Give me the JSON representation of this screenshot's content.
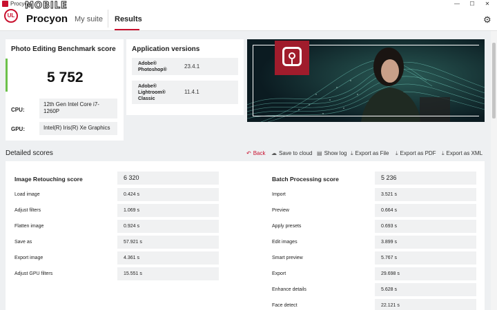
{
  "window": {
    "title": "Procyon",
    "controls": [
      "—",
      "☐",
      "✕"
    ]
  },
  "header": {
    "logo_text": "UL",
    "brand": "Procyon",
    "watermark": "MOBILE",
    "tabs": [
      {
        "label": "My suite",
        "active": false
      },
      {
        "label": "Results",
        "active": true
      }
    ],
    "settings_icon": "gear-icon"
  },
  "score_card": {
    "title": "Photo Editing Benchmark score",
    "score": "5 752",
    "cpu_label": "CPU:",
    "cpu_value": "12th Gen Intel Core i7-1260P",
    "gpu_label": "GPU:",
    "gpu_value": "Intel(R) Iris(R) Xe Graphics"
  },
  "app_versions": {
    "title": "Application versions",
    "items": [
      {
        "name": "Adobe® Photoshop®",
        "version": "23.4.1"
      },
      {
        "name": "Adobe® Lightroom® Classic",
        "version": "11.4.1"
      }
    ]
  },
  "detailed": {
    "title": "Detailed scores",
    "actions": [
      {
        "label": "Back",
        "icon": "back-arrow-icon"
      },
      {
        "label": "Save to cloud",
        "icon": "cloud-icon"
      },
      {
        "label": "Show log",
        "icon": "document-icon"
      },
      {
        "label": "Export as File",
        "icon": "export-icon"
      },
      {
        "label": "Export as PDF",
        "icon": "export-icon"
      },
      {
        "label": "Export as XML",
        "icon": "export-icon"
      }
    ],
    "left": {
      "title": "Image Retouching score",
      "score": "6 320",
      "rows": [
        {
          "label": "Load image",
          "value": "0.424 s"
        },
        {
          "label": "Adjust filters",
          "value": "1.069 s"
        },
        {
          "label": "Flatten image",
          "value": "0.924 s"
        },
        {
          "label": "Save as",
          "value": "57.921 s"
        },
        {
          "label": "Export image",
          "value": "4.361 s"
        },
        {
          "label": "Adjust GPU filters",
          "value": "15.551 s"
        }
      ]
    },
    "right": {
      "title": "Batch Processing score",
      "score": "5 236",
      "rows": [
        {
          "label": "Import",
          "value": "3.521 s"
        },
        {
          "label": "Preview",
          "value": "0.664 s"
        },
        {
          "label": "Apply presets",
          "value": "0.693 s"
        },
        {
          "label": "Edit images",
          "value": "3.899 s"
        },
        {
          "label": "Smart preview",
          "value": "5.767 s"
        },
        {
          "label": "Export",
          "value": "29.698 s"
        },
        {
          "label": "Enhance details",
          "value": "5.628 s"
        },
        {
          "label": "Face detect",
          "value": "22.121 s"
        }
      ]
    }
  },
  "colors": {
    "accent": "#c8102e",
    "score_bar": "#6cc04a"
  }
}
